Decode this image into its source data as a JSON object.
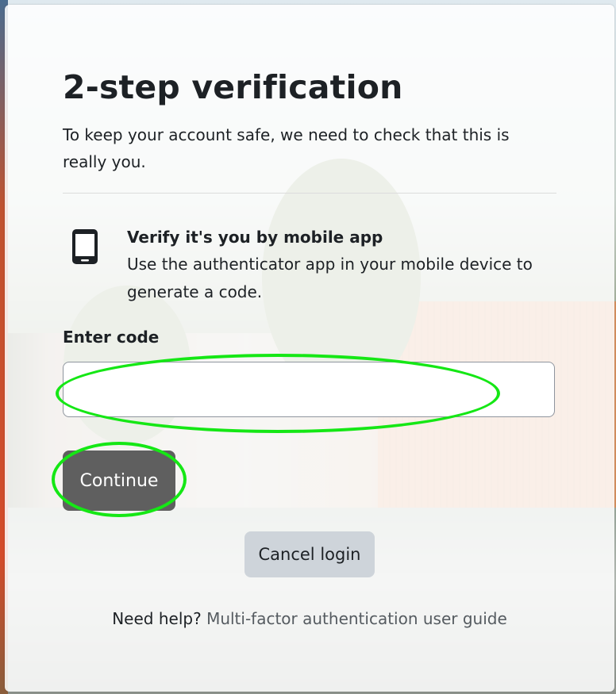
{
  "page": {
    "title": "2-step verification",
    "subtitle": "To keep your account safe, we need to check that this is really you."
  },
  "method": {
    "icon": "mobile-phone-icon",
    "title": "Verify it's you by mobile app",
    "description": "Use the authenticator app in your mobile device to generate a code."
  },
  "code_field": {
    "label": "Enter code",
    "value": "",
    "placeholder": ""
  },
  "buttons": {
    "continue_label": "Continue",
    "cancel_label": "Cancel login"
  },
  "help": {
    "prefix": "Need help?",
    "link_text": "Multi-factor authentication user guide"
  },
  "colors": {
    "highlight": "#15e715",
    "primary_button": "#5f5f5f",
    "secondary_button": "#ced4da",
    "text": "#1d2125"
  }
}
